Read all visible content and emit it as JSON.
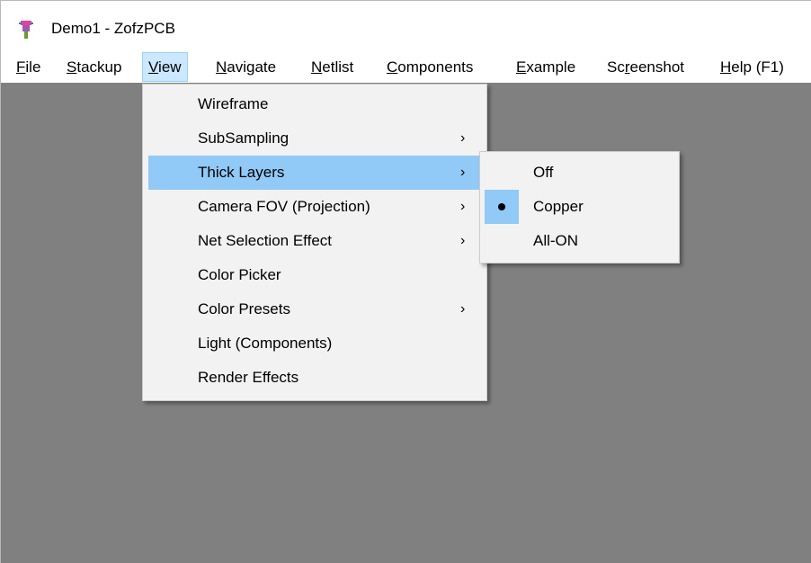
{
  "window": {
    "title": "Demo1 - ZofzPCB",
    "icon": "zofzpcb-app-icon"
  },
  "menubar": {
    "items": [
      {
        "label_u": "F",
        "label_rest": "ile"
      },
      {
        "label_u": "S",
        "label_rest": "tackup"
      },
      {
        "label_u": "V",
        "label_rest": "iew"
      },
      {
        "label_u": "N",
        "label_rest": "avigate"
      },
      {
        "label_u": "N",
        "label_rest": "etlist"
      },
      {
        "label_u": "C",
        "label_rest": "omponents"
      },
      {
        "label_u": "E",
        "label_rest": "xample"
      },
      {
        "label_pre": "Sc",
        "label_u": "r",
        "label_rest": "eenshot"
      },
      {
        "label_u": "H",
        "label_rest": "elp (F1)"
      }
    ],
    "active": "View"
  },
  "view_menu": {
    "items": [
      {
        "label": "Wireframe",
        "submenu": false
      },
      {
        "label": "SubSampling",
        "submenu": true
      },
      {
        "label": "Thick Layers",
        "submenu": true,
        "highlighted": true
      },
      {
        "label": "Camera FOV (Projection)",
        "submenu": true
      },
      {
        "label": "Net Selection Effect",
        "submenu": true
      },
      {
        "label": "Color Picker",
        "submenu": false
      },
      {
        "label": "Color Presets",
        "submenu": true
      },
      {
        "label": "Light (Components)",
        "submenu": false
      },
      {
        "label": "Render Effects",
        "submenu": false
      }
    ],
    "arrow_glyph": "›"
  },
  "thick_layers_submenu": {
    "items": [
      {
        "label": "Off",
        "selected": false
      },
      {
        "label": "Copper",
        "selected": true
      },
      {
        "label": "All-ON",
        "selected": false
      }
    ]
  },
  "colors": {
    "canvas": "#808080",
    "menu_bg": "#f2f2f2",
    "highlight": "#91c9f7",
    "menubar_active": "#cce8ff"
  }
}
